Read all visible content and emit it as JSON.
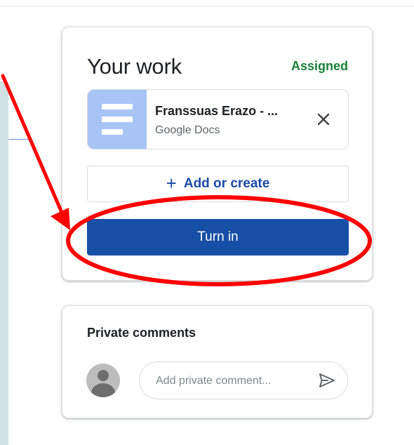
{
  "work": {
    "title": "Your work",
    "status": "Assigned",
    "attachment": {
      "name": "Franssuas Erazo - ...",
      "type": "Google Docs",
      "thumbnail_icon": "google-docs-icon",
      "remove_icon": "close-icon"
    },
    "add_create": {
      "icon": "plus-icon",
      "label": "Add or create"
    },
    "turn_in_label": "Turn in"
  },
  "comments": {
    "title": "Private comments",
    "avatar_icon": "default-avatar-icon",
    "placeholder": "Add private comment...",
    "send_icon": "send-icon"
  },
  "colors": {
    "status_green": "#188038",
    "primary_blue": "#174ea6",
    "link_blue": "#1a4aa8",
    "doc_thumb": "#a7c4f5",
    "annotation_red": "#ff0000"
  }
}
